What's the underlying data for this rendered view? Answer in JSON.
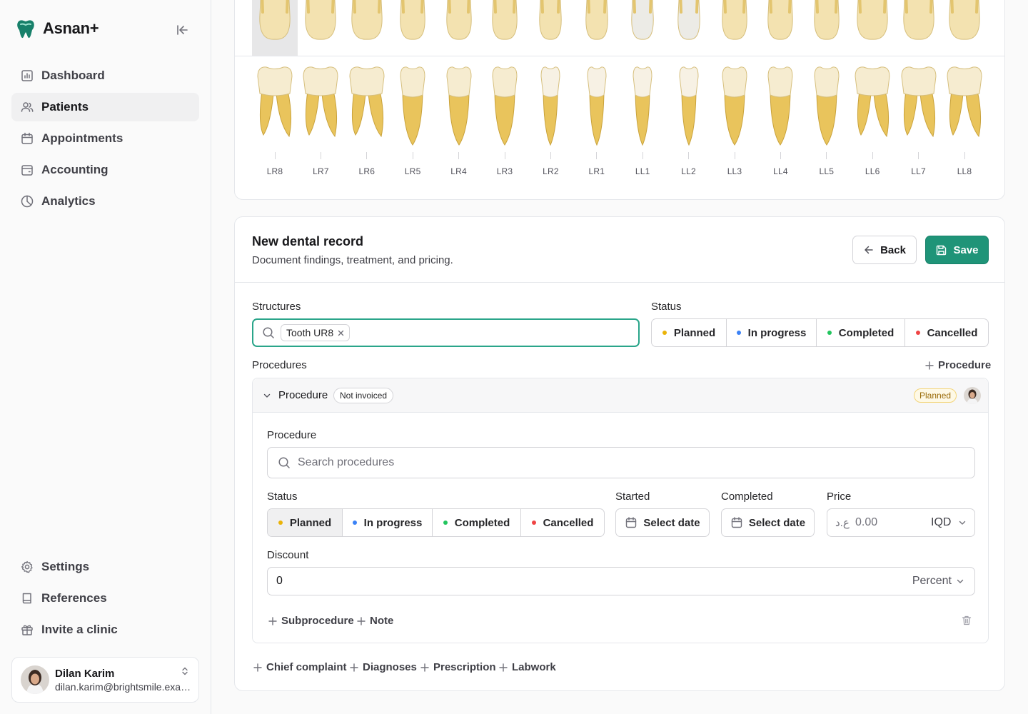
{
  "sidebar": {
    "brand": "Asnan+",
    "nav": [
      {
        "label": "Dashboard",
        "icon": "dashboard-icon"
      },
      {
        "label": "Patients",
        "icon": "users-icon",
        "active": true
      },
      {
        "label": "Appointments",
        "icon": "calendar-icon"
      },
      {
        "label": "Accounting",
        "icon": "wallet-icon"
      },
      {
        "label": "Analytics",
        "icon": "pie-chart-icon"
      }
    ],
    "bottom_nav": [
      {
        "label": "Settings",
        "icon": "gear-icon"
      },
      {
        "label": "References",
        "icon": "book-icon"
      },
      {
        "label": "Invite a clinic",
        "icon": "gift-icon"
      }
    ],
    "user": {
      "name": "Dilan Karim",
      "email": "dilan.karim@brightsmile.example"
    }
  },
  "tooth_chart": {
    "upper_selected": "UR8",
    "lower_teeth": [
      "LR8",
      "LR7",
      "LR6",
      "LR5",
      "LR4",
      "LR3",
      "LR2",
      "LR1",
      "LL1",
      "LL2",
      "LL3",
      "LL4",
      "LL5",
      "LL6",
      "LL7",
      "LL8"
    ]
  },
  "record": {
    "title": "New dental record",
    "subtitle": "Document findings, treatment, and pricing.",
    "back_label": "Back",
    "save_label": "Save",
    "structures_label": "Structures",
    "structure_chip": "Tooth UR8",
    "status_label": "Status",
    "statuses": [
      {
        "label": "Planned",
        "color": "#eab308"
      },
      {
        "label": "In progress",
        "color": "#3b82f6"
      },
      {
        "label": "Completed",
        "color": "#22c55e"
      },
      {
        "label": "Cancelled",
        "color": "#ef4444"
      }
    ],
    "procedures_label": "Procedures",
    "add_procedure": "Procedure",
    "procedure": {
      "header_title": "Procedure",
      "invoice_badge": "Not invoiced",
      "status_badge": "Planned",
      "procedure_label": "Procedure",
      "search_placeholder": "Search procedures",
      "status_label": "Status",
      "selected_status": "Planned",
      "started_label": "Started",
      "started_value": "Select date",
      "completed_label": "Completed",
      "completed_value": "Select date",
      "price_label": "Price",
      "price_prefix": "ع.د",
      "price_placeholder": "0.00",
      "currency": "IQD",
      "discount_label": "Discount",
      "discount_value": "0",
      "discount_unit": "Percent",
      "add_subprocedure": "Subprocedure",
      "add_note": "Note"
    },
    "footer_links": [
      "Chief complaint",
      "Diagnoses",
      "Prescription",
      "Labwork"
    ]
  },
  "colors": {
    "accent": "#1f9478",
    "focus": "#2aa58a"
  }
}
